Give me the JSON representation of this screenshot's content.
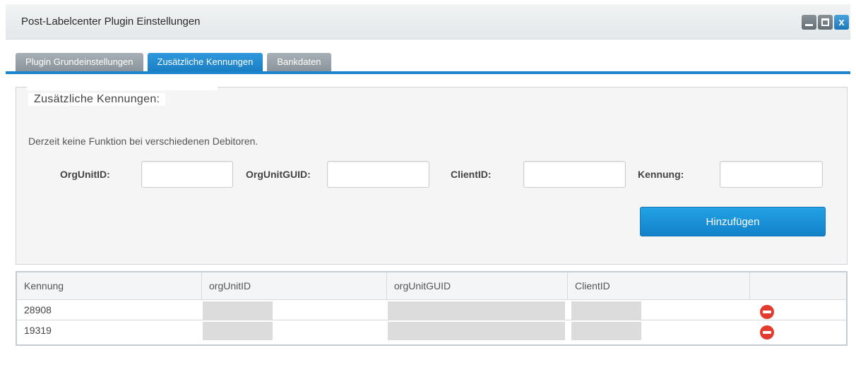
{
  "window": {
    "title": "Post-Labelcenter Plugin Einstellungen",
    "buttons": [
      "minimize-icon",
      "maximize-icon",
      "close-icon"
    ],
    "close_glyph": "x"
  },
  "tabs": [
    {
      "label": "Plugin Grundeinstellungen",
      "active": false
    },
    {
      "label": "Zusätzliche Kennungen",
      "active": true
    },
    {
      "label": "Bankdaten",
      "active": false
    }
  ],
  "section": {
    "legend": "Zusätzliche Kennungen:",
    "info": "Derzeit keine Funktion bei verschiedenen Debitoren.",
    "fields": [
      {
        "label": "OrgUnitID:",
        "value": "",
        "placeholder": ""
      },
      {
        "label": "OrgUnitGUID:",
        "value": "",
        "placeholder": ""
      },
      {
        "label": "ClientID:",
        "value": "",
        "placeholder": ""
      },
      {
        "label": "Kennung:",
        "value": "",
        "placeholder": ""
      }
    ],
    "add_button": "Hinzufügen"
  },
  "table": {
    "columns": [
      "Kennung",
      "orgUnitID",
      "orgUnitGUID",
      "ClientID",
      ""
    ],
    "rows": [
      {
        "kennung": "28908",
        "orgUnitID": "",
        "orgUnitGUID": "",
        "clientID": "",
        "delete_icon": "delete-icon"
      },
      {
        "kennung": "19319",
        "orgUnitID": "",
        "orgUnitGUID": "",
        "clientID": "",
        "delete_icon": "delete-icon"
      }
    ]
  },
  "colors": {
    "accent": "#1b85cd",
    "button": "#1a8fd6",
    "delete": "#e23b2e",
    "tab_inactive": "#97a1a7"
  }
}
